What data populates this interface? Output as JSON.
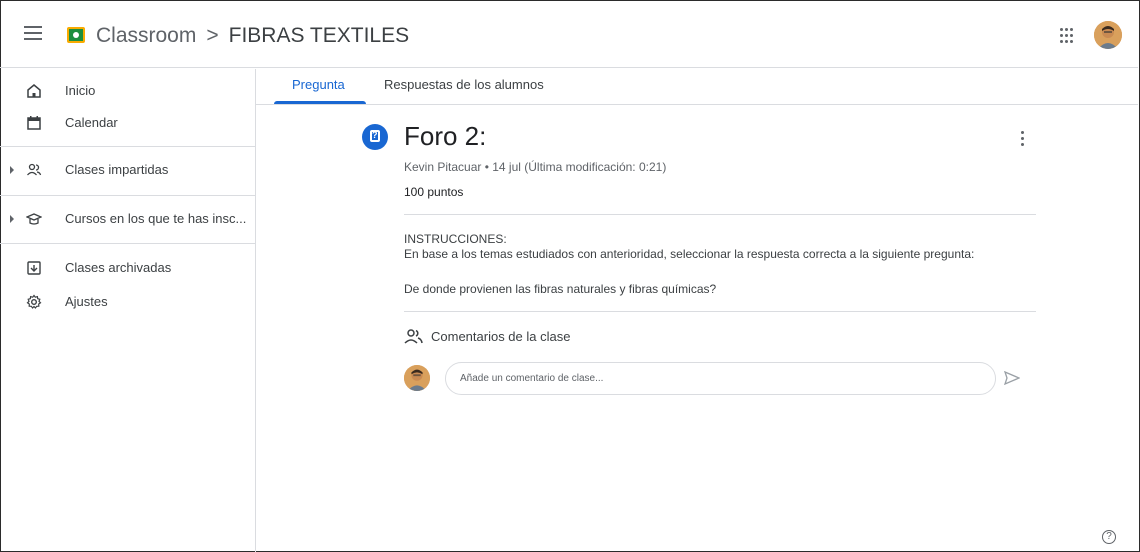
{
  "header": {
    "app_name": "Classroom",
    "separator": ">",
    "class_name": "FIBRAS TEXTILES"
  },
  "sidebar": {
    "items": [
      {
        "label": "Inicio",
        "icon": "home-icon"
      },
      {
        "label": "Calendar",
        "icon": "calendar-icon"
      },
      {
        "label": "Clases impartidas",
        "icon": "people-icon"
      },
      {
        "label": "Cursos en los que te has insc...",
        "icon": "school-icon"
      },
      {
        "label": "Clases archivadas",
        "icon": "archive-icon"
      },
      {
        "label": "Ajustes",
        "icon": "gear-icon"
      }
    ]
  },
  "tabs": [
    {
      "label": "Pregunta",
      "active": true
    },
    {
      "label": "Respuestas de los alumnos",
      "active": false
    }
  ],
  "post": {
    "title": "Foro 2:",
    "meta": "Kevin Pitacuar • 14 jul (Última modificación: 0:21)",
    "points": "100 puntos",
    "instructions_title": "INSTRUCCIONES:",
    "instructions_body": "En base a los temas estudiados con anterioridad, seleccionar la respuesta correcta a la siguiente pregunta:",
    "question": "De donde provienen las fibras naturales y fibras químicas?"
  },
  "comments": {
    "heading": "Comentarios de la clase",
    "placeholder": "Añade un comentario de clase..."
  },
  "help": {
    "symbol": "?"
  },
  "colors": {
    "accent": "#1967d2",
    "brand_green": "#1e8e3e",
    "brand_yellow": "#f9ab00",
    "text": "#3c4043",
    "muted": "#5f6368",
    "divider": "#dadce0"
  }
}
